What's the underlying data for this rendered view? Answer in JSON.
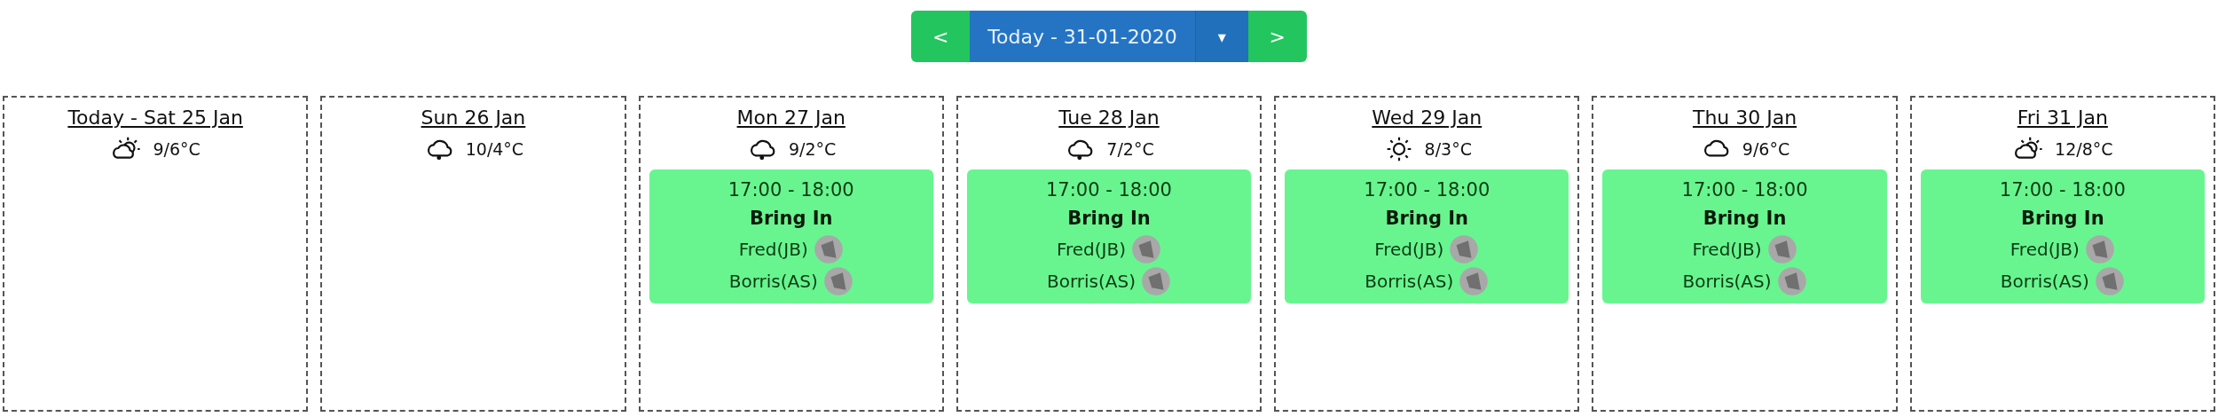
{
  "nav": {
    "prev": "<",
    "current": "Today - 31-01-2020",
    "caret": "▾",
    "next": ">"
  },
  "days": [
    {
      "title": "Today - Sat 25 Jan",
      "weather": {
        "kind": "partly-cloudy",
        "temp": "9/6°C"
      }
    },
    {
      "title": "Sun 26 Jan",
      "weather": {
        "kind": "rain",
        "temp": "10/4°C"
      }
    },
    {
      "title": "Mon 27 Jan",
      "weather": {
        "kind": "rain",
        "temp": "9/2°C"
      },
      "events": [
        {
          "time": "17:00 - 18:00",
          "title": "Bring In",
          "people": [
            "Fred(JB)",
            "Borris(AS)"
          ]
        }
      ]
    },
    {
      "title": "Tue 28 Jan",
      "weather": {
        "kind": "rain",
        "temp": "7/2°C"
      },
      "events": [
        {
          "time": "17:00 - 18:00",
          "title": "Bring In",
          "people": [
            "Fred(JB)",
            "Borris(AS)"
          ]
        }
      ]
    },
    {
      "title": "Wed 29 Jan",
      "weather": {
        "kind": "sun",
        "temp": "8/3°C"
      },
      "events": [
        {
          "time": "17:00 - 18:00",
          "title": "Bring In",
          "people": [
            "Fred(JB)",
            "Borris(AS)"
          ]
        }
      ]
    },
    {
      "title": "Thu 30 Jan",
      "weather": {
        "kind": "cloud",
        "temp": "9/6°C"
      },
      "events": [
        {
          "time": "17:00 - 18:00",
          "title": "Bring In",
          "people": [
            "Fred(JB)",
            "Borris(AS)"
          ]
        }
      ]
    },
    {
      "title": "Fri 31 Jan",
      "weather": {
        "kind": "partly-cloudy",
        "temp": "12/8°C"
      },
      "events": [
        {
          "time": "17:00 - 18:00",
          "title": "Bring In",
          "people": [
            "Fred(JB)",
            "Borris(AS)"
          ]
        }
      ]
    }
  ]
}
